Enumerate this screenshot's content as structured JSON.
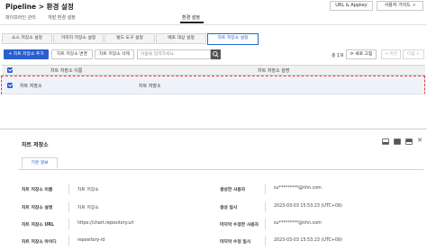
{
  "header": {
    "title": "Pipeline > 환경 설정",
    "url_appkey_label": "URL & Appkey",
    "user_guide_label": "사용자 가이드",
    "external_icon": "external-link-icon"
  },
  "subnav": {
    "items": [
      "파이프라인 관리",
      "개발 환경 설정",
      "환경 설정"
    ],
    "active_index": 2
  },
  "tabs": {
    "items": [
      "소스 저장소 설정",
      "이미지 저장소 설정",
      "빌드 도구 설정",
      "배포 대상 설정",
      "차트 저장소 설정"
    ],
    "active_index": 4
  },
  "toolbar": {
    "add_label": "+ 차트 저장소 추가",
    "edit_label": "차트 저장소 변경",
    "delete_label": "차트 저장소 삭제",
    "search_placeholder": "이름을 입력하세요.",
    "count_label": "총 1개",
    "refresh_label": "⟳ 새로 고침",
    "prev_label": "< 이전",
    "next_label": "다음 >"
  },
  "table": {
    "columns": [
      "차트 저장소 이름",
      "차트 저장소 설명"
    ],
    "rows": [
      {
        "name": "차트 저장소",
        "description": "차트 저장소",
        "selected": true
      }
    ]
  },
  "detail": {
    "title": "차트 저장소",
    "tab_label": "기본 정보",
    "left_fields": [
      {
        "label": "차트 저장소 이름",
        "value": "차트 저장소"
      },
      {
        "label": "차트 저장소 설명",
        "value": "차트 저장소"
      },
      {
        "label": "차트 저장소 URL",
        "value": "https://chart.repository.url"
      },
      {
        "label": "차트 저장소 아이디",
        "value": "repository-id"
      }
    ],
    "right_fields": [
      {
        "label": "생성한 사용자",
        "value": "su*********@nhn.com"
      },
      {
        "label": "생성 일시",
        "value": "2023-03-03 15:53:23 (UTC+09)"
      },
      {
        "label": "마지막 수정한 사용자",
        "value": "su*********@nhn.com"
      },
      {
        "label": "마지막 수정 일시",
        "value": "2023-03-03 15:53:23 (UTC+09)"
      }
    ]
  },
  "colors": {
    "accent": "#2a5fd0",
    "selection_outline": "#e53935",
    "selected_row": "#eef3fb"
  }
}
